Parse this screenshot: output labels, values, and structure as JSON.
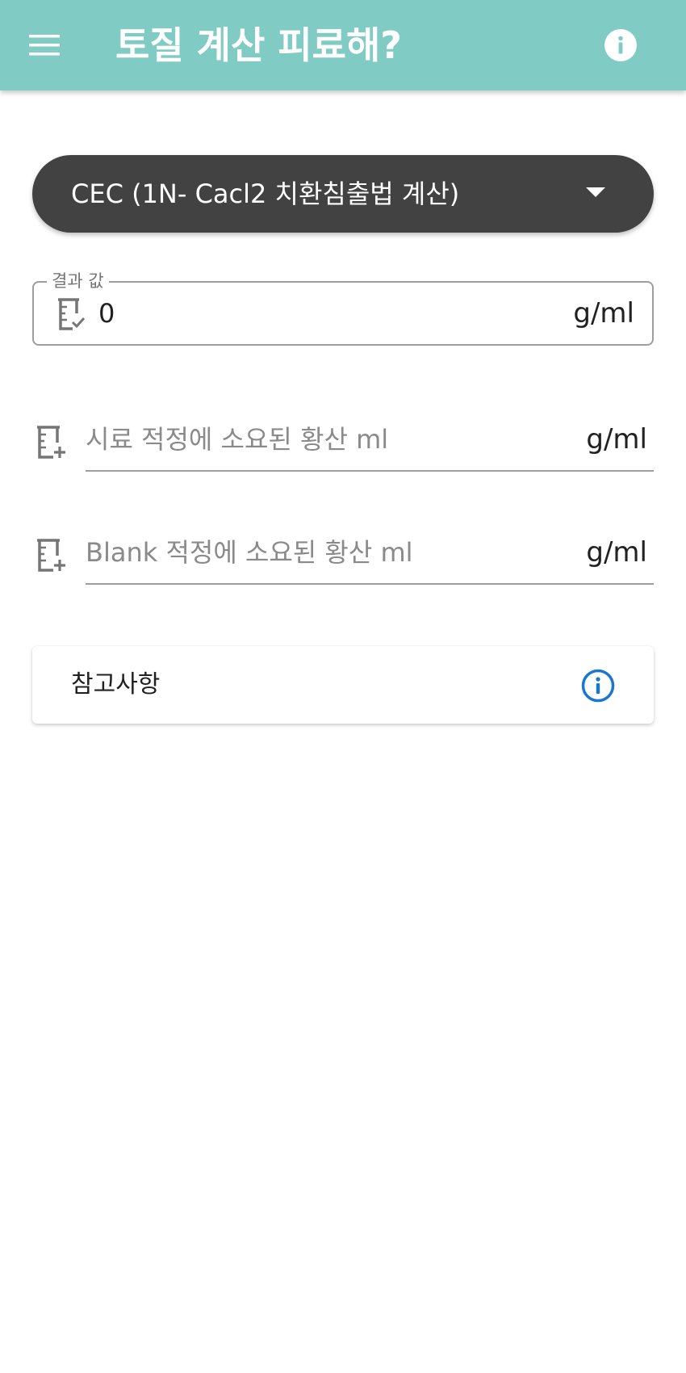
{
  "app_bar": {
    "title": "토질 계산 피료해?",
    "background_color": "#80cbc4",
    "menu_icon": "hamburger-menu-icon",
    "info_icon": "info-circle-icon"
  },
  "calc_type_dropdown": {
    "selected": "CEC (1N- Cacl2 치환침출법 계산)",
    "background_color": "#424242"
  },
  "result_field": {
    "label": "결과 값",
    "value": "0",
    "unit": "g/ml",
    "icon": "beaker-check-icon"
  },
  "inputs": [
    {
      "placeholder": "시료 적정에 소요된 황산 ml",
      "value": "",
      "unit": "g/ml",
      "icon": "beaker-plus-icon"
    },
    {
      "placeholder": "Blank 적정에 소요된 황산 ml",
      "value": "",
      "unit": "g/ml",
      "icon": "beaker-plus-icon"
    }
  ],
  "notes_card": {
    "label": "참고사항",
    "icon": "info-outline-icon",
    "icon_color": "#1976d2"
  }
}
